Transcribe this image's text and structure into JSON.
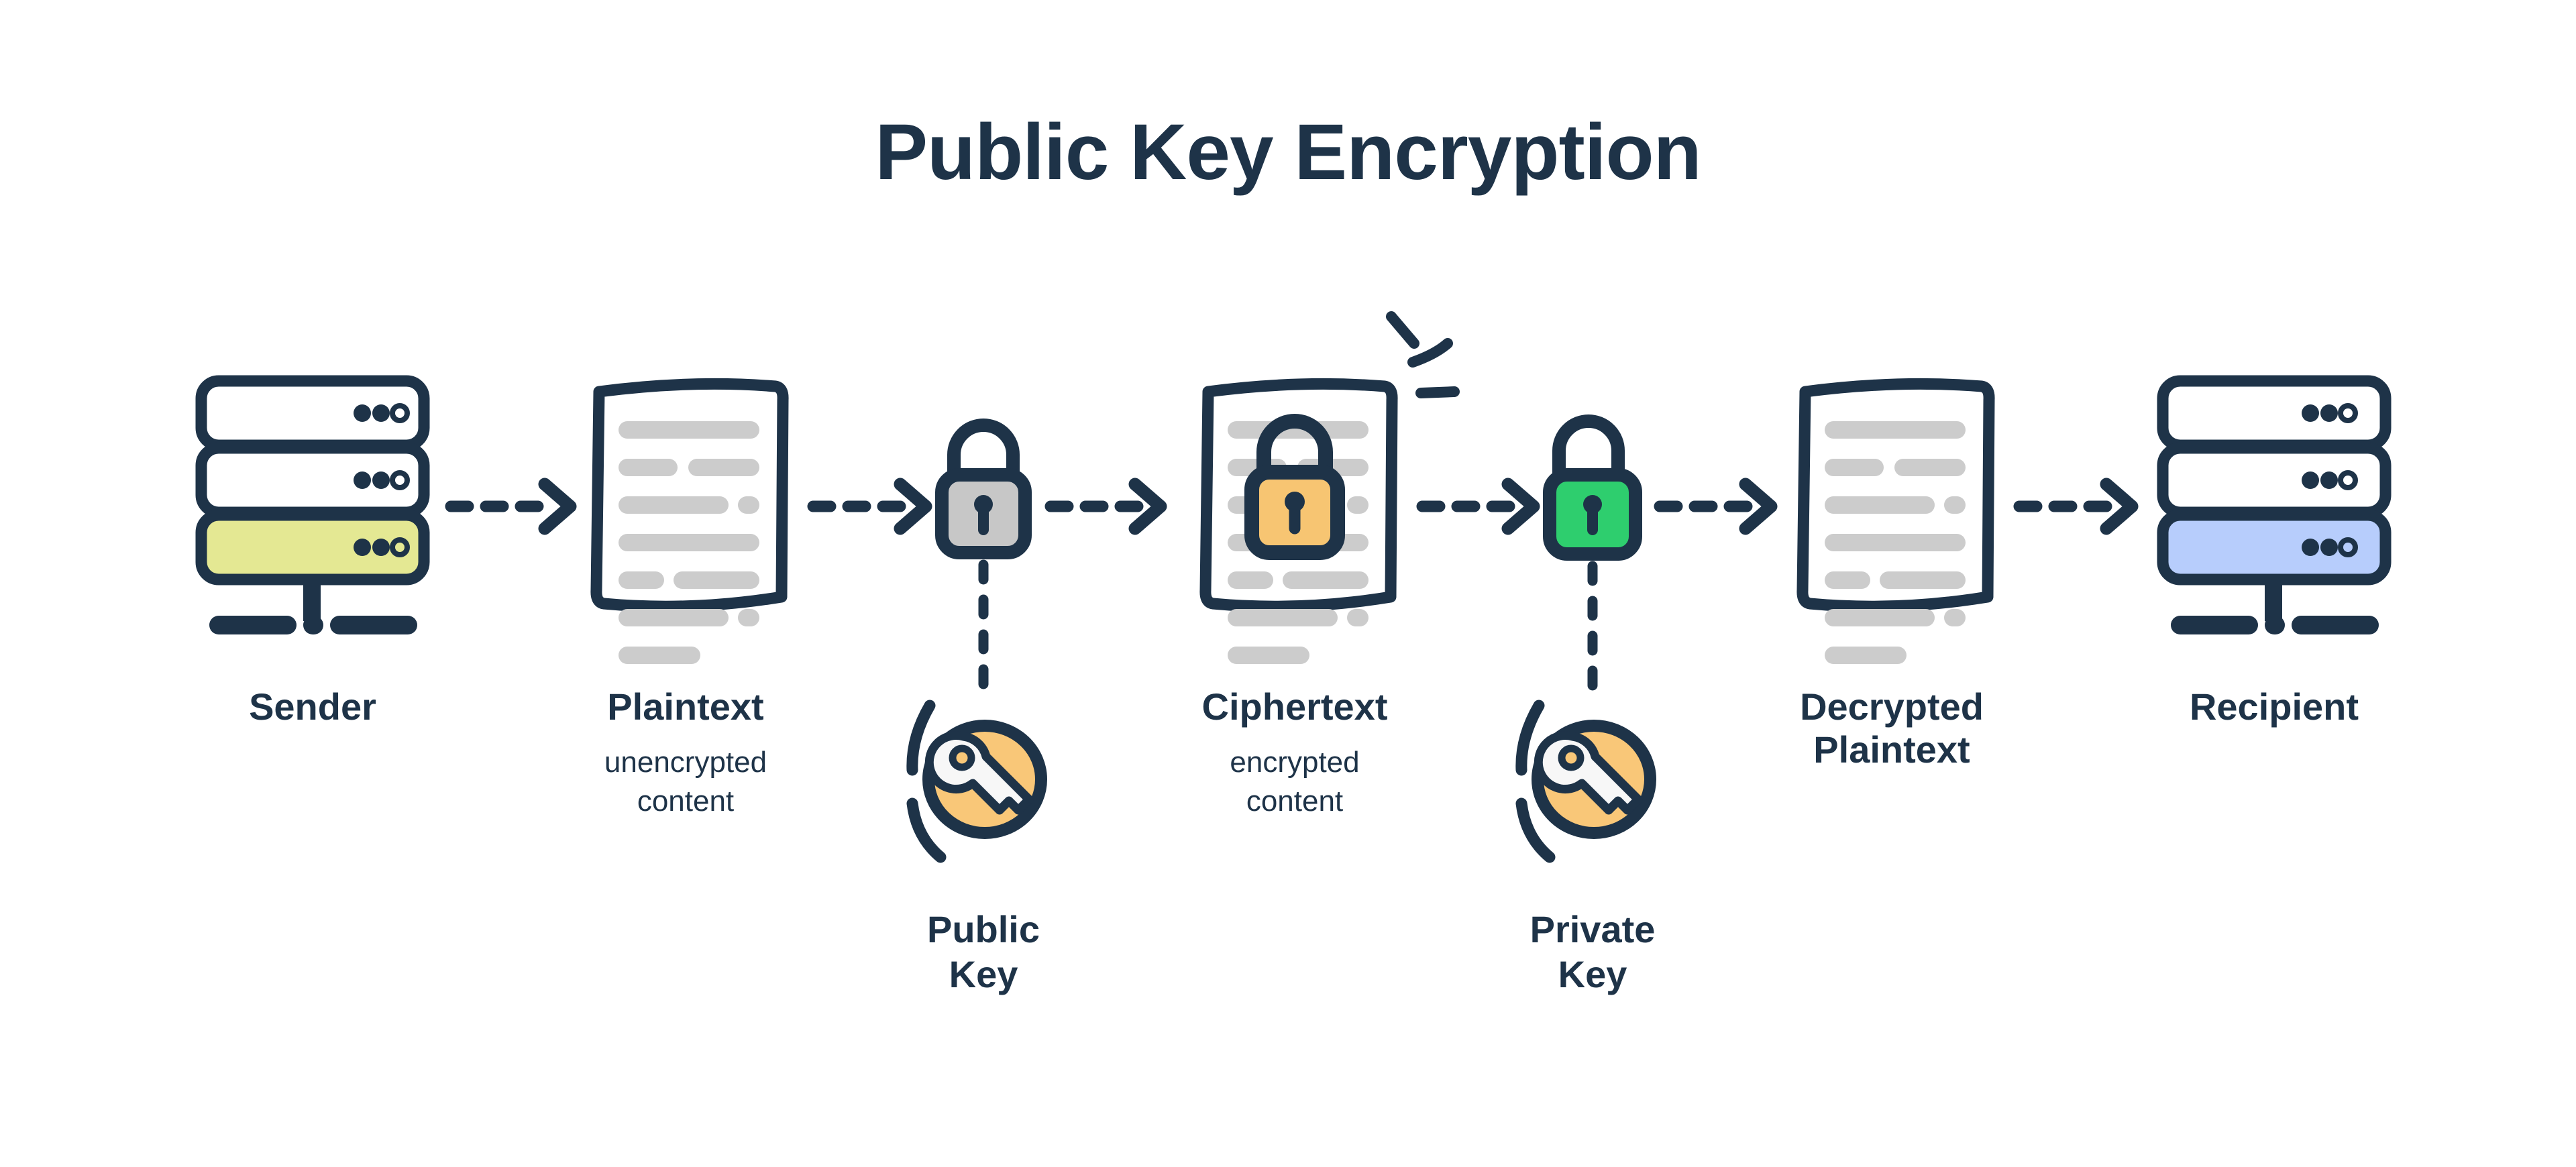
{
  "title": "Public Key Encryption",
  "colors": {
    "ink": "#1e3348",
    "doc_line": "#cccccc",
    "sender_accent": "#e4e893",
    "recipient_accent": "#b7cdfc",
    "lock_closed_gray": "#c7c7c7",
    "lock_locked_orange": "#f7c572",
    "lock_open_green": "#2ece6e",
    "key_circle_orange": "#f9c778",
    "key_body_white": "#f7f7f7",
    "background": "#ffffff"
  },
  "nodes": [
    {
      "id": "sender",
      "icon": "server-stack-icon",
      "label": "Sender",
      "sub": "",
      "accent": "#e4e893"
    },
    {
      "id": "plaintext",
      "icon": "document-icon",
      "label": "Plaintext",
      "sub": "unencrypted\ncontent",
      "accent": ""
    },
    {
      "id": "public-lock",
      "icon": "padlock-closed-gray-icon",
      "label": "",
      "sub": "",
      "accent": "#c7c7c7"
    },
    {
      "id": "ciphertext",
      "icon": "document-locked-icon",
      "label": "Ciphertext",
      "sub": "encrypted\ncontent",
      "accent": "#f7c572"
    },
    {
      "id": "private-unlock",
      "icon": "padlock-open-green-icon",
      "label": "",
      "sub": "",
      "accent": "#2ece6e"
    },
    {
      "id": "decrypted",
      "icon": "document-icon",
      "label": "Decrypted\nPlaintext",
      "sub": "",
      "accent": ""
    },
    {
      "id": "recipient",
      "icon": "server-stack-icon",
      "label": "Recipient",
      "sub": "",
      "accent": "#b7cdfc"
    }
  ],
  "keys": [
    {
      "id": "public-key",
      "icon": "key-circle-icon",
      "label": "Public\nKey"
    },
    {
      "id": "private-key",
      "icon": "key-circle-icon",
      "label": "Private\nKey"
    }
  ],
  "flow": {
    "arrow_count": 6,
    "arrow_style": "dashed-right-chevron",
    "vertical_link_style": "dashed-vertical"
  },
  "document_lines": [
    [
      100
    ],
    [
      42,
      54
    ],
    [
      78,
      16
    ],
    [
      100
    ],
    [
      32,
      64
    ],
    [
      78,
      16
    ],
    [
      58
    ]
  ]
}
